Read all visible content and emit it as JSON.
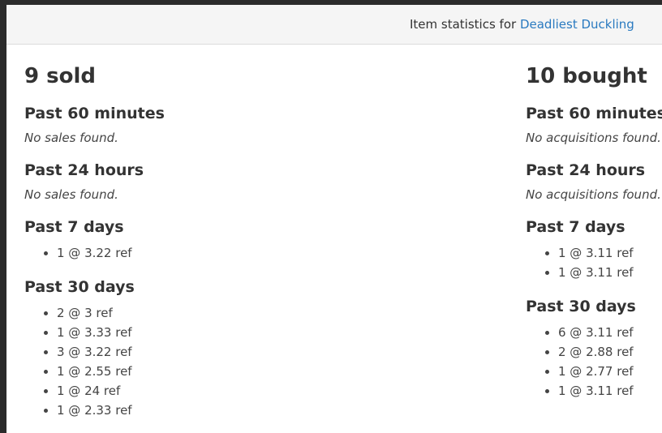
{
  "header": {
    "prefix": "Item statistics for",
    "item_name": "Deadliest Duckling"
  },
  "sold": {
    "heading": "9 sold",
    "periods": [
      {
        "title": "Past 60 minutes",
        "empty": "No sales found.",
        "entries": []
      },
      {
        "title": "Past 24 hours",
        "empty": "No sales found.",
        "entries": []
      },
      {
        "title": "Past 7 days",
        "empty": "",
        "entries": [
          "1 @ 3.22 ref"
        ]
      },
      {
        "title": "Past 30 days",
        "empty": "",
        "entries": [
          "2 @ 3 ref",
          "1 @ 3.33 ref",
          "3 @ 3.22 ref",
          "1 @ 2.55 ref",
          "1 @ 24 ref",
          "1 @ 2.33 ref"
        ]
      }
    ]
  },
  "bought": {
    "heading": "10 bought",
    "periods": [
      {
        "title": "Past 60 minutes",
        "empty": "No acquisitions found.",
        "entries": []
      },
      {
        "title": "Past 24 hours",
        "empty": "No acquisitions found.",
        "entries": []
      },
      {
        "title": "Past 7 days",
        "empty": "",
        "entries": [
          "1 @ 3.11 ref",
          "1 @ 3.11 ref"
        ]
      },
      {
        "title": "Past 30 days",
        "empty": "",
        "entries": [
          "6 @ 3.11 ref",
          "2 @ 2.88 ref",
          "1 @ 2.77 ref",
          "1 @ 3.11 ref"
        ]
      }
    ]
  },
  "colors": {
    "link": "#2a7ac0",
    "text": "#333333",
    "header_bg": "#f5f5f5",
    "backdrop": "#2b2b2b"
  }
}
